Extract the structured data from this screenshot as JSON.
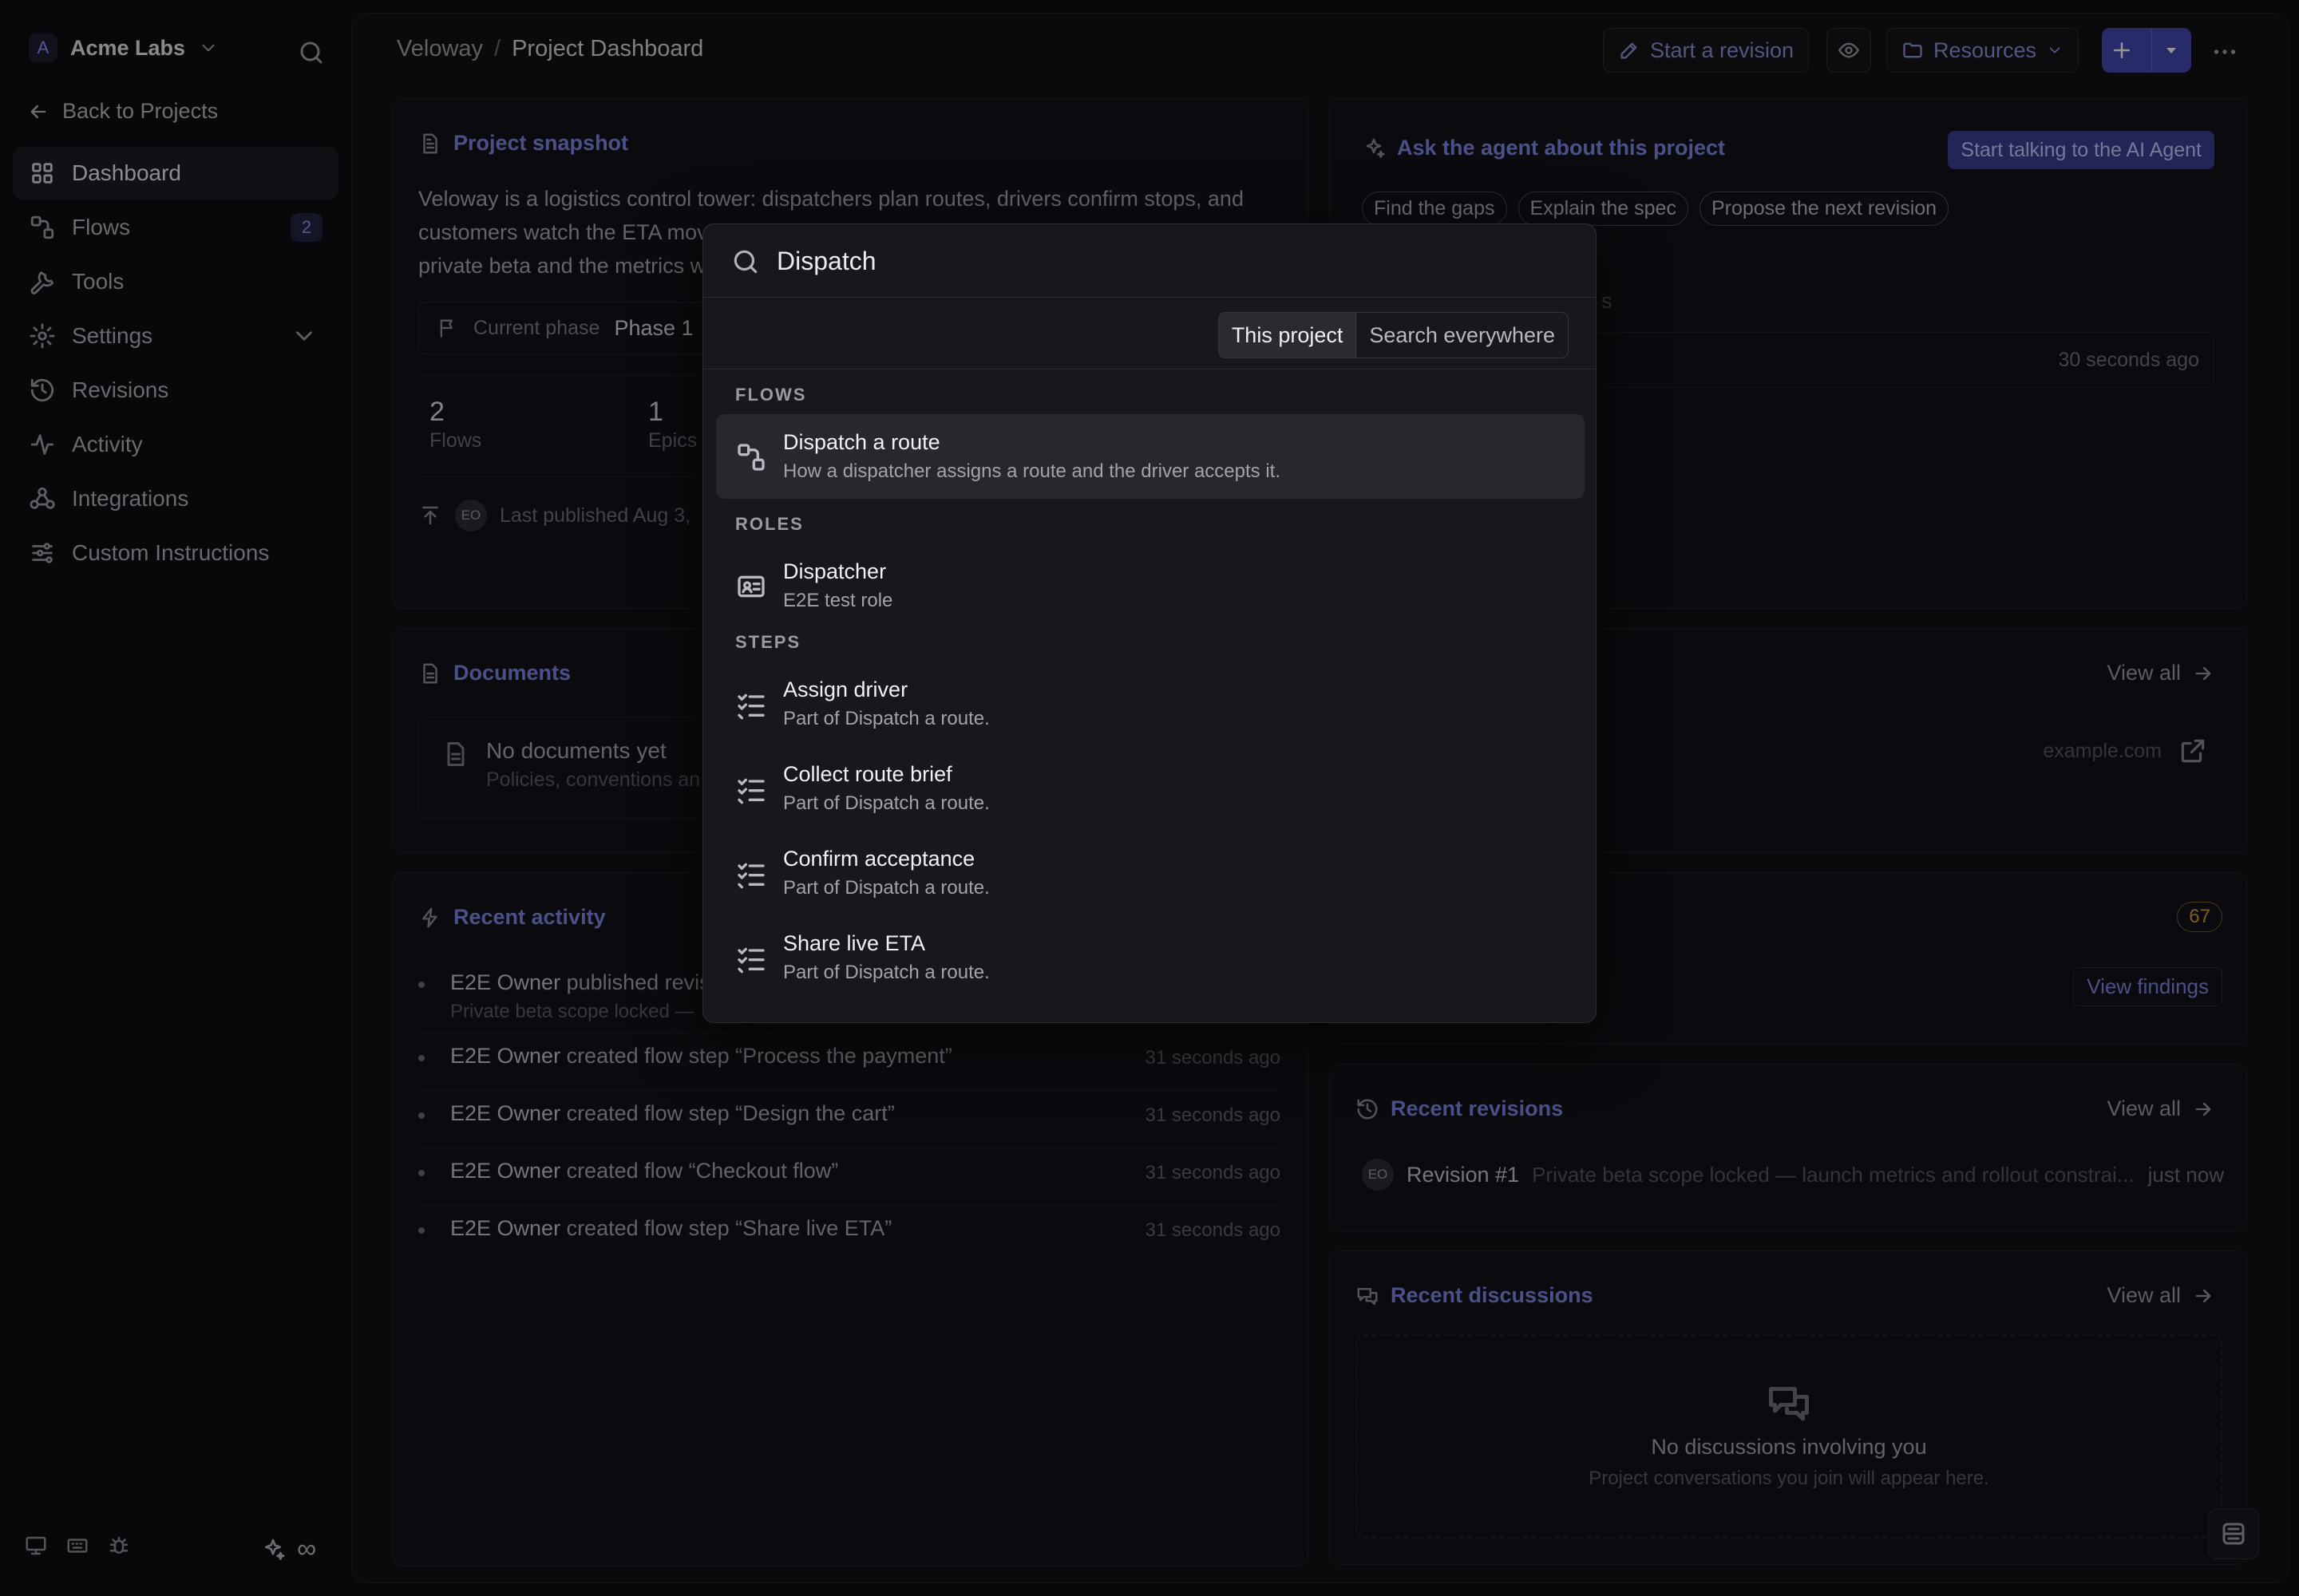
{
  "workspace": {
    "initial": "A",
    "name": "Acme Labs"
  },
  "sidebar": {
    "back_label": "Back to Projects",
    "items": [
      {
        "label": "Dashboard"
      },
      {
        "label": "Flows",
        "badge": "2"
      },
      {
        "label": "Tools"
      },
      {
        "label": "Settings"
      },
      {
        "label": "Revisions"
      },
      {
        "label": "Activity"
      },
      {
        "label": "Integrations"
      },
      {
        "label": "Custom Instructions"
      }
    ],
    "bottom_right_symbol": "∞"
  },
  "header": {
    "breadcrumb": [
      "Veloway",
      "Project Dashboard"
    ],
    "separator": "/",
    "start_revision": "Start a revision",
    "resources": "Resources"
  },
  "snapshot": {
    "title": "Project snapshot",
    "description": "Veloway is a logistics control tower: dispatchers plan routes, drivers confirm stops, and customers watch the ETA mov",
    "description_line3": "private beta and the metrics w",
    "phase_label": "Current phase",
    "phase_value": "Phase 1",
    "stats": [
      {
        "n": "2",
        "l": "Flows"
      },
      {
        "n": "1",
        "l": "Epics"
      }
    ],
    "avatar": "EO",
    "published": "Last published Aug 3,"
  },
  "agent": {
    "title": "Ask the agent about this project",
    "cta": "Start talking to the AI Agent",
    "chips": [
      "Find the gaps",
      "Explain the spec",
      "Propose the next revision"
    ],
    "fragment": "s",
    "row_time": "30 seconds ago"
  },
  "documents": {
    "title": "Documents",
    "empty_title": "No documents yet",
    "empty_sub": "Policies, conventions an"
  },
  "links": {
    "view_all": "View all",
    "url": "example.com"
  },
  "activity": {
    "title": "Recent activity",
    "items": [
      {
        "who": "E2E Owner",
        "what": " published revis",
        "sub": "Private beta scope locked —",
        "time": ""
      },
      {
        "who": "E2E Owner",
        "what": " created flow step “Process the payment”",
        "time": "31 seconds ago"
      },
      {
        "who": "E2E Owner",
        "what": " created flow step “Design the cart”",
        "time": "31 seconds ago"
      },
      {
        "who": "E2E Owner",
        "what": " created flow “Checkout flow”",
        "time": "31 seconds ago"
      },
      {
        "who": "E2E Owner",
        "what": " created flow step “Share live ETA”",
        "time": "31 seconds ago"
      }
    ]
  },
  "findings": {
    "count": "67",
    "button": "View findings"
  },
  "revisions": {
    "title": "Recent revisions",
    "view_all": "View all",
    "avatar": "EO",
    "name": "Revision #1",
    "desc": "Private beta scope locked — launch metrics and rollout constrai...",
    "time": "just now"
  },
  "discussions": {
    "title": "Recent discussions",
    "view_all": "View all",
    "empty_title": "No discussions involving you",
    "empty_sub": "Project conversations you join will appear here."
  },
  "palette": {
    "query": "Dispatch",
    "scopes": [
      "This project",
      "Search everywhere"
    ],
    "groups": [
      {
        "label": "FLOWS",
        "results": [
          {
            "title": "Dispatch a route",
            "desc": "How a dispatcher assigns a route and the driver accepts it.",
            "icon": "flow-icon",
            "selected": true
          }
        ]
      },
      {
        "label": "ROLES",
        "results": [
          {
            "title": "Dispatcher",
            "desc": "E2E test role",
            "icon": "id-card-icon"
          }
        ]
      },
      {
        "label": "STEPS",
        "results": [
          {
            "title": "Assign driver",
            "desc": "Part of Dispatch a route.",
            "icon": "checklist-icon"
          },
          {
            "title": "Collect route brief",
            "desc": "Part of Dispatch a route.",
            "icon": "checklist-icon"
          },
          {
            "title": "Confirm acceptance",
            "desc": "Part of Dispatch a route.",
            "icon": "checklist-icon"
          },
          {
            "title": "Share live ETA",
            "desc": "Part of Dispatch a route.",
            "icon": "checklist-icon"
          }
        ]
      }
    ]
  },
  "colors": {
    "accent": "#4148b0",
    "link": "#7f88e6",
    "warning": "#d29c3a"
  }
}
